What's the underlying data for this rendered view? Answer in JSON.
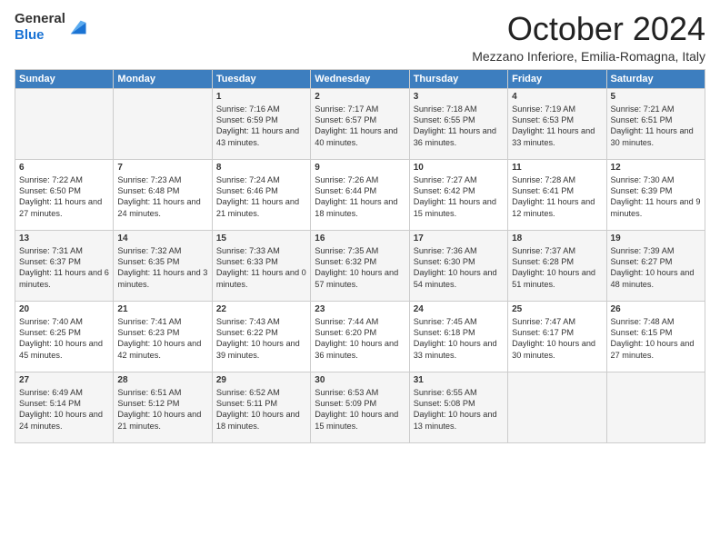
{
  "logo": {
    "line1": "General",
    "line2": "Blue"
  },
  "title": "October 2024",
  "location": "Mezzano Inferiore, Emilia-Romagna, Italy",
  "headers": [
    "Sunday",
    "Monday",
    "Tuesday",
    "Wednesday",
    "Thursday",
    "Friday",
    "Saturday"
  ],
  "weeks": [
    [
      {
        "day": "",
        "sunrise": "",
        "sunset": "",
        "daylight": ""
      },
      {
        "day": "",
        "sunrise": "",
        "sunset": "",
        "daylight": ""
      },
      {
        "day": "1",
        "sunrise": "Sunrise: 7:16 AM",
        "sunset": "Sunset: 6:59 PM",
        "daylight": "Daylight: 11 hours and 43 minutes."
      },
      {
        "day": "2",
        "sunrise": "Sunrise: 7:17 AM",
        "sunset": "Sunset: 6:57 PM",
        "daylight": "Daylight: 11 hours and 40 minutes."
      },
      {
        "day": "3",
        "sunrise": "Sunrise: 7:18 AM",
        "sunset": "Sunset: 6:55 PM",
        "daylight": "Daylight: 11 hours and 36 minutes."
      },
      {
        "day": "4",
        "sunrise": "Sunrise: 7:19 AM",
        "sunset": "Sunset: 6:53 PM",
        "daylight": "Daylight: 11 hours and 33 minutes."
      },
      {
        "day": "5",
        "sunrise": "Sunrise: 7:21 AM",
        "sunset": "Sunset: 6:51 PM",
        "daylight": "Daylight: 11 hours and 30 minutes."
      }
    ],
    [
      {
        "day": "6",
        "sunrise": "Sunrise: 7:22 AM",
        "sunset": "Sunset: 6:50 PM",
        "daylight": "Daylight: 11 hours and 27 minutes."
      },
      {
        "day": "7",
        "sunrise": "Sunrise: 7:23 AM",
        "sunset": "Sunset: 6:48 PM",
        "daylight": "Daylight: 11 hours and 24 minutes."
      },
      {
        "day": "8",
        "sunrise": "Sunrise: 7:24 AM",
        "sunset": "Sunset: 6:46 PM",
        "daylight": "Daylight: 11 hours and 21 minutes."
      },
      {
        "day": "9",
        "sunrise": "Sunrise: 7:26 AM",
        "sunset": "Sunset: 6:44 PM",
        "daylight": "Daylight: 11 hours and 18 minutes."
      },
      {
        "day": "10",
        "sunrise": "Sunrise: 7:27 AM",
        "sunset": "Sunset: 6:42 PM",
        "daylight": "Daylight: 11 hours and 15 minutes."
      },
      {
        "day": "11",
        "sunrise": "Sunrise: 7:28 AM",
        "sunset": "Sunset: 6:41 PM",
        "daylight": "Daylight: 11 hours and 12 minutes."
      },
      {
        "day": "12",
        "sunrise": "Sunrise: 7:30 AM",
        "sunset": "Sunset: 6:39 PM",
        "daylight": "Daylight: 11 hours and 9 minutes."
      }
    ],
    [
      {
        "day": "13",
        "sunrise": "Sunrise: 7:31 AM",
        "sunset": "Sunset: 6:37 PM",
        "daylight": "Daylight: 11 hours and 6 minutes."
      },
      {
        "day": "14",
        "sunrise": "Sunrise: 7:32 AM",
        "sunset": "Sunset: 6:35 PM",
        "daylight": "Daylight: 11 hours and 3 minutes."
      },
      {
        "day": "15",
        "sunrise": "Sunrise: 7:33 AM",
        "sunset": "Sunset: 6:33 PM",
        "daylight": "Daylight: 11 hours and 0 minutes."
      },
      {
        "day": "16",
        "sunrise": "Sunrise: 7:35 AM",
        "sunset": "Sunset: 6:32 PM",
        "daylight": "Daylight: 10 hours and 57 minutes."
      },
      {
        "day": "17",
        "sunrise": "Sunrise: 7:36 AM",
        "sunset": "Sunset: 6:30 PM",
        "daylight": "Daylight: 10 hours and 54 minutes."
      },
      {
        "day": "18",
        "sunrise": "Sunrise: 7:37 AM",
        "sunset": "Sunset: 6:28 PM",
        "daylight": "Daylight: 10 hours and 51 minutes."
      },
      {
        "day": "19",
        "sunrise": "Sunrise: 7:39 AM",
        "sunset": "Sunset: 6:27 PM",
        "daylight": "Daylight: 10 hours and 48 minutes."
      }
    ],
    [
      {
        "day": "20",
        "sunrise": "Sunrise: 7:40 AM",
        "sunset": "Sunset: 6:25 PM",
        "daylight": "Daylight: 10 hours and 45 minutes."
      },
      {
        "day": "21",
        "sunrise": "Sunrise: 7:41 AM",
        "sunset": "Sunset: 6:23 PM",
        "daylight": "Daylight: 10 hours and 42 minutes."
      },
      {
        "day": "22",
        "sunrise": "Sunrise: 7:43 AM",
        "sunset": "Sunset: 6:22 PM",
        "daylight": "Daylight: 10 hours and 39 minutes."
      },
      {
        "day": "23",
        "sunrise": "Sunrise: 7:44 AM",
        "sunset": "Sunset: 6:20 PM",
        "daylight": "Daylight: 10 hours and 36 minutes."
      },
      {
        "day": "24",
        "sunrise": "Sunrise: 7:45 AM",
        "sunset": "Sunset: 6:18 PM",
        "daylight": "Daylight: 10 hours and 33 minutes."
      },
      {
        "day": "25",
        "sunrise": "Sunrise: 7:47 AM",
        "sunset": "Sunset: 6:17 PM",
        "daylight": "Daylight: 10 hours and 30 minutes."
      },
      {
        "day": "26",
        "sunrise": "Sunrise: 7:48 AM",
        "sunset": "Sunset: 6:15 PM",
        "daylight": "Daylight: 10 hours and 27 minutes."
      }
    ],
    [
      {
        "day": "27",
        "sunrise": "Sunrise: 6:49 AM",
        "sunset": "Sunset: 5:14 PM",
        "daylight": "Daylight: 10 hours and 24 minutes."
      },
      {
        "day": "28",
        "sunrise": "Sunrise: 6:51 AM",
        "sunset": "Sunset: 5:12 PM",
        "daylight": "Daylight: 10 hours and 21 minutes."
      },
      {
        "day": "29",
        "sunrise": "Sunrise: 6:52 AM",
        "sunset": "Sunset: 5:11 PM",
        "daylight": "Daylight: 10 hours and 18 minutes."
      },
      {
        "day": "30",
        "sunrise": "Sunrise: 6:53 AM",
        "sunset": "Sunset: 5:09 PM",
        "daylight": "Daylight: 10 hours and 15 minutes."
      },
      {
        "day": "31",
        "sunrise": "Sunrise: 6:55 AM",
        "sunset": "Sunset: 5:08 PM",
        "daylight": "Daylight: 10 hours and 13 minutes."
      },
      {
        "day": "",
        "sunrise": "",
        "sunset": "",
        "daylight": ""
      },
      {
        "day": "",
        "sunrise": "",
        "sunset": "",
        "daylight": ""
      }
    ]
  ]
}
